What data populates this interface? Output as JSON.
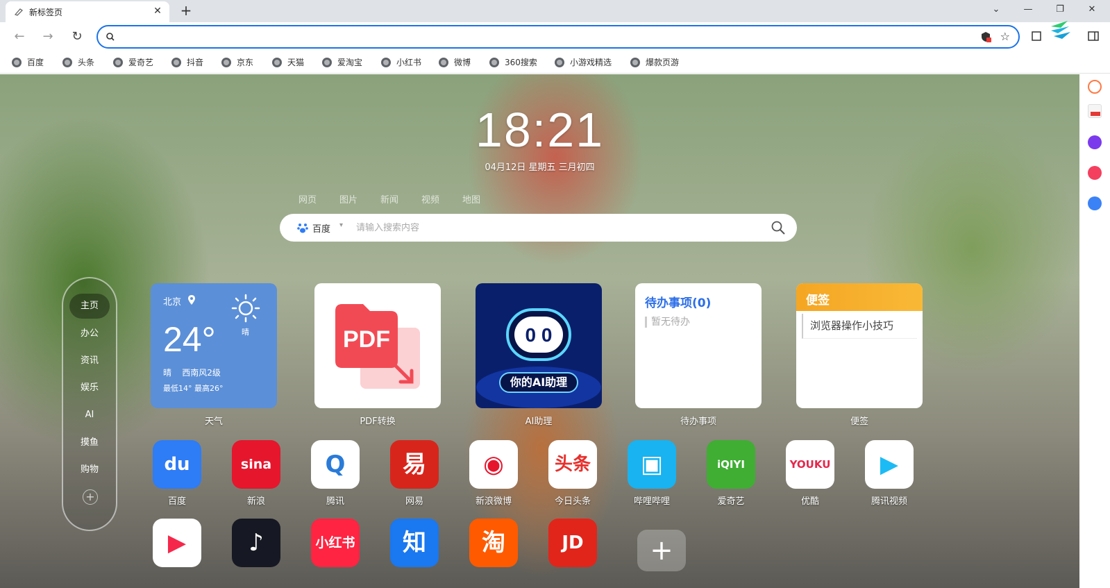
{
  "tab": {
    "title": "新标签页",
    "close": "✕",
    "new_tab": "+"
  },
  "window_controls": {
    "dropdown": "⌄",
    "minimize": "—",
    "restore": "❐",
    "close": "✕"
  },
  "toolbar": {
    "back": "←",
    "forward": "→",
    "reload": "↻",
    "address_value": "",
    "star": "☆"
  },
  "bookmarks": [
    "百度",
    "头条",
    "爱奇艺",
    "抖音",
    "京东",
    "天猫",
    "爱淘宝",
    "小红书",
    "微博",
    "360搜索",
    "小游戏精选",
    "爆款页游"
  ],
  "clock": {
    "time": "18:21",
    "date": "04月12日 星期五 三月初四"
  },
  "search": {
    "tabs": [
      "网页",
      "图片",
      "新闻",
      "视频",
      "地图"
    ],
    "engine": "百度",
    "placeholder": "请输入搜索内容"
  },
  "left_nav": {
    "items": [
      "主页",
      "办公",
      "资讯",
      "娱乐",
      "AI",
      "摸鱼",
      "购物"
    ],
    "add": "+"
  },
  "widgets": {
    "weather": {
      "city": "北京",
      "temp": "24°",
      "cond_short": "晴",
      "cond": "晴    西南风2级",
      "range": "最低14° 最高26°",
      "label": "天气"
    },
    "pdf": {
      "label": "PDF转换",
      "icon_text": "PDF"
    },
    "ai": {
      "label": "AI助理",
      "badge": "你的AI助理",
      "face": "0 0"
    },
    "todo": {
      "title": "待办事项(0)",
      "empty": "暂无待办",
      "label": "待办事项"
    },
    "note": {
      "title": "便签",
      "item": "浏览器操作小技巧",
      "label": "便签"
    }
  },
  "apps_row1": [
    {
      "label": "百度",
      "glyph": "du",
      "bg": "#2e7cf6",
      "fg": "#ffffff"
    },
    {
      "label": "新浪",
      "glyph": "sina",
      "bg": "#e6162d",
      "fg": "#ffffff"
    },
    {
      "label": "腾讯",
      "glyph": "Q",
      "bg": "#ffffff",
      "fg": "#2a7bd8"
    },
    {
      "label": "网易",
      "glyph": "易",
      "bg": "#d8251b",
      "fg": "#ffffff"
    },
    {
      "label": "新浪微博",
      "glyph": "◉",
      "bg": "#ffffff",
      "fg": "#e6162d"
    },
    {
      "label": "今日头条",
      "glyph": "头条",
      "bg": "#ffffff",
      "fg": "#e8302c"
    },
    {
      "label": "哔哩哔哩",
      "glyph": "▣",
      "bg": "#18b3f0",
      "fg": "#ffffff"
    },
    {
      "label": "爱奇艺",
      "glyph": "iQIYI",
      "bg": "#3fae33",
      "fg": "#ffffff"
    },
    {
      "label": "优酷",
      "glyph": "YOUKU",
      "bg": "#ffffff",
      "fg": "#e5274c"
    },
    {
      "label": "腾讯视频",
      "glyph": "▶",
      "bg": "#ffffff",
      "fg": "#1dbbf5"
    }
  ],
  "apps_row2": [
    {
      "glyph": "▶",
      "bg": "#ffffff",
      "fg": "#f5284b"
    },
    {
      "glyph": "♪",
      "bg": "#161823",
      "fg": "#ffffff"
    },
    {
      "glyph": "小红书",
      "bg": "#ff2442",
      "fg": "#ffffff"
    },
    {
      "glyph": "知",
      "bg": "#1a78f0",
      "fg": "#ffffff"
    },
    {
      "glyph": "淘",
      "bg": "#ff5a00",
      "fg": "#ffffff"
    },
    {
      "glyph": "JD",
      "bg": "#e1251b",
      "fg": "#ffffff"
    }
  ],
  "add_app": "+"
}
